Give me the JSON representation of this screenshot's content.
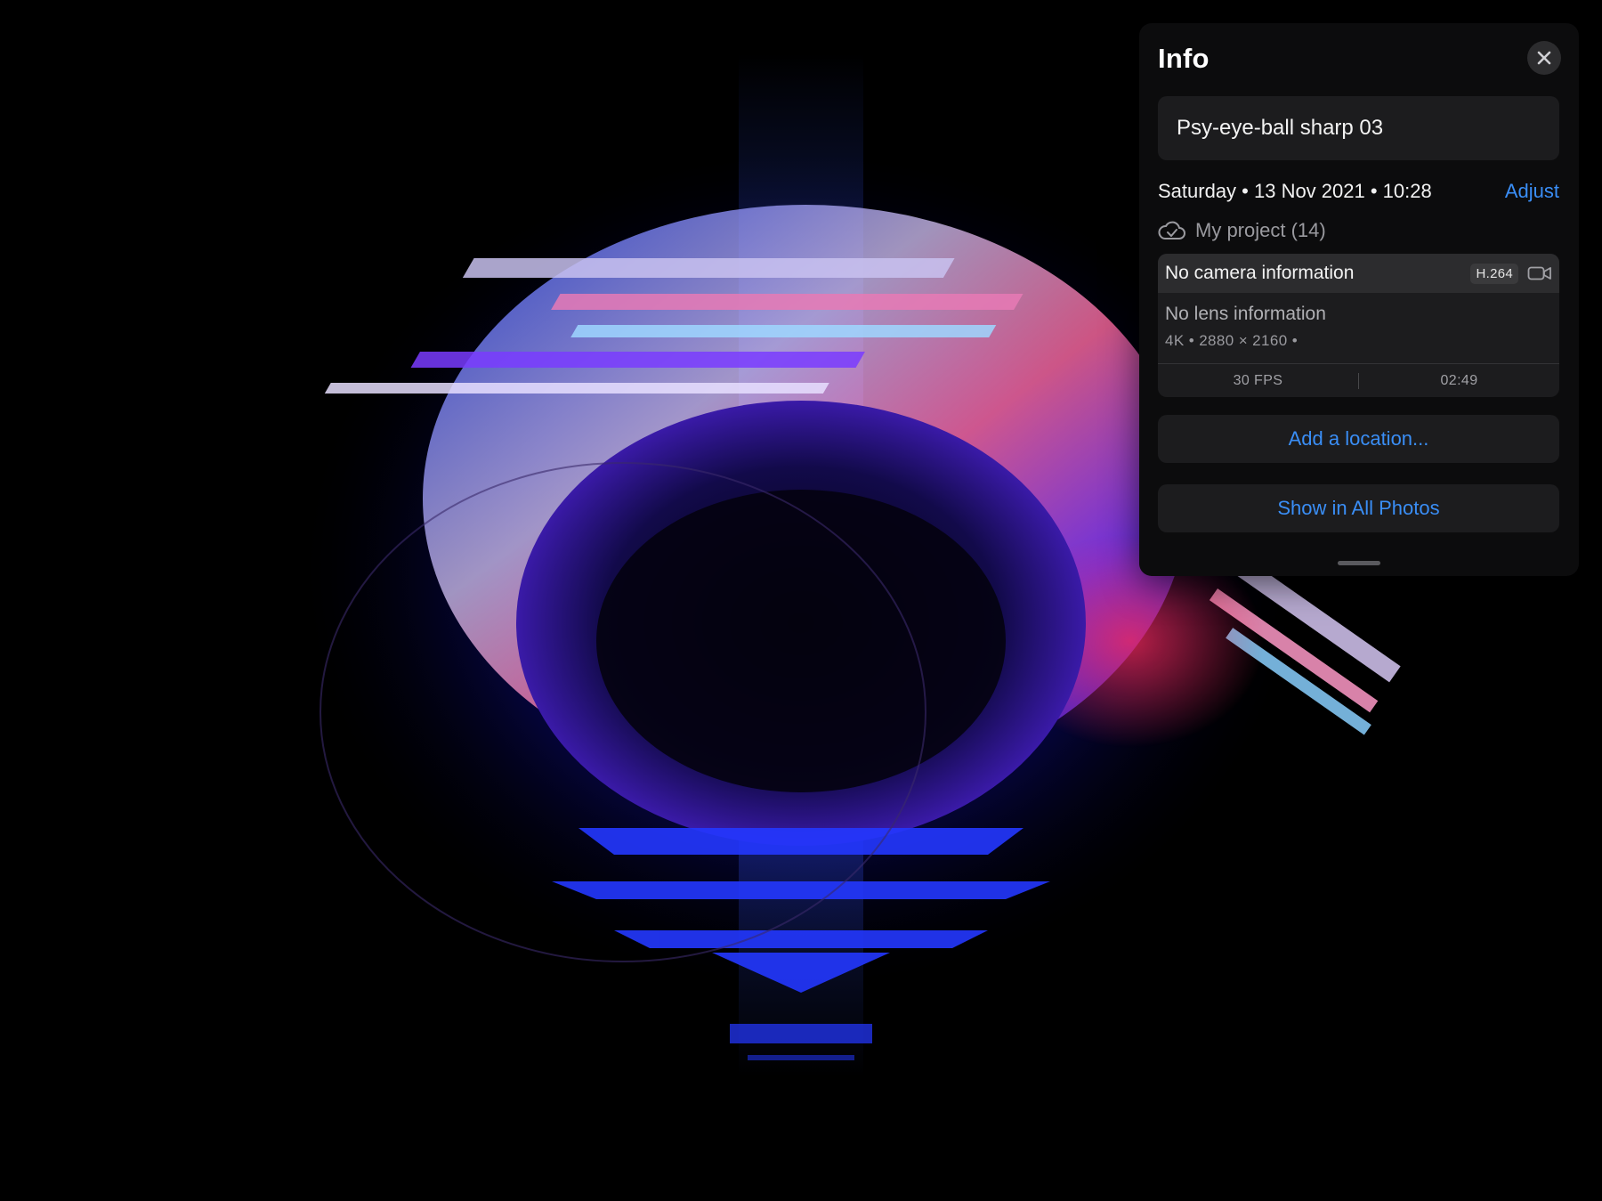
{
  "info_panel": {
    "title": "Info",
    "photo_title": "Psy-eye-ball sharp 03",
    "date": "Saturday • 13 Nov 2021 • 10:28",
    "adjust_label": "Adjust",
    "album": "My project (14)",
    "camera": {
      "camera_info": "No camera information",
      "codec": "H.264",
      "lens_info": "No lens information",
      "specs": "4K • 2880 × 2160 •",
      "fps": "30 FPS",
      "duration": "02:49"
    },
    "add_location_label": "Add a location...",
    "show_in_all_photos_label": "Show in All Photos"
  },
  "icons": {
    "close": "close-icon",
    "cloud": "cloud-icon",
    "video": "video-camera-icon"
  },
  "colors": {
    "accent": "#3a8ef6",
    "panel_bg": "#0c0c0d",
    "card_bg": "#1c1c1e"
  }
}
